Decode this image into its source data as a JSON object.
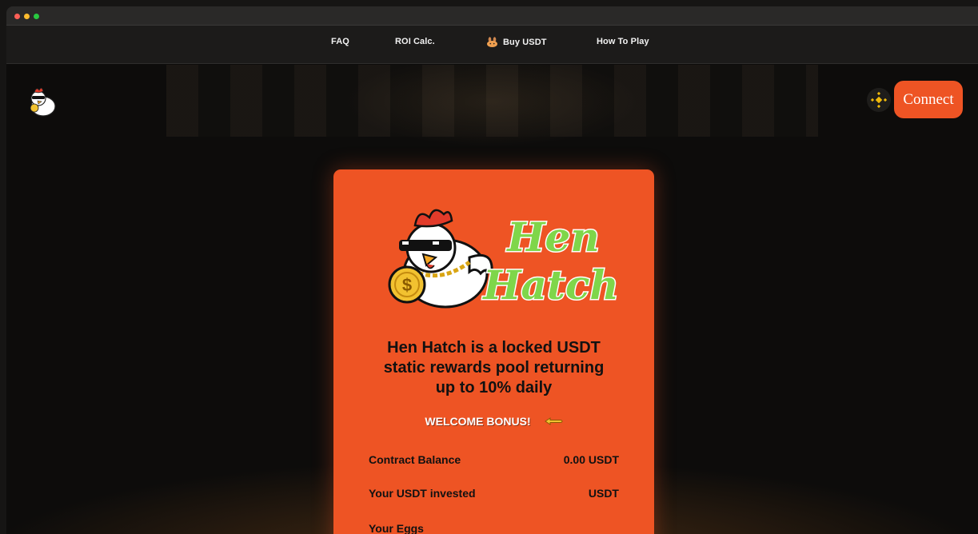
{
  "nav": {
    "items": [
      {
        "label": "FAQ"
      },
      {
        "label": "ROI Calc."
      },
      {
        "label": "Buy USDT",
        "icon": "pancake-bunny-icon"
      },
      {
        "label": "How To Play"
      }
    ]
  },
  "header": {
    "connect_label": "Connect",
    "chain_icon": "binance-icon"
  },
  "card": {
    "brand_line1": "Hen",
    "brand_line2": "Hatch",
    "tagline_line1": "Hen Hatch is a locked USDT",
    "tagline_line2": "static rewards pool returning",
    "tagline_line3": "up to 10% daily",
    "bonus_label": "WELCOME BONUS!",
    "stats": [
      {
        "label": "Contract Balance",
        "value": "0.00 USDT"
      },
      {
        "label": "Your USDT invested",
        "value": "USDT"
      },
      {
        "label": "Your Eggs",
        "value": ""
      }
    ]
  },
  "colors": {
    "accent": "#ee5424",
    "brand_green": "#7fd64a",
    "background": "#0d0c0b"
  }
}
